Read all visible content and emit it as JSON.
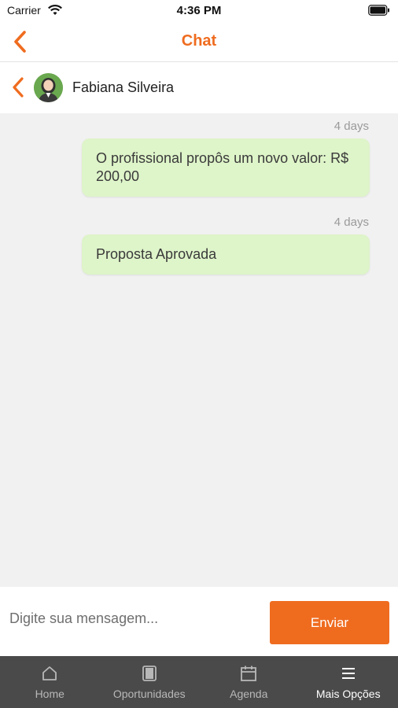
{
  "status_bar": {
    "carrier": "Carrier",
    "time": "4:36 PM"
  },
  "header": {
    "title": "Chat",
    "back_icon": "chevron-left-icon"
  },
  "contact": {
    "name": "Fabiana Silveira",
    "avatar_icon": "user-avatar"
  },
  "messages": [
    {
      "time": "4 days",
      "text": "O profissional propôs um novo valor: R$ 200,00"
    },
    {
      "time": "4 days",
      "text": "Proposta Aprovada"
    }
  ],
  "composer": {
    "placeholder": "Digite sua mensagem...",
    "send_label": "Enviar"
  },
  "tabs": [
    {
      "label": "Home",
      "icon": "home-icon"
    },
    {
      "label": "Oportunidades",
      "icon": "tablet-icon"
    },
    {
      "label": "Agenda",
      "icon": "calendar-icon"
    },
    {
      "label": "Mais Opções",
      "icon": "menu-icon",
      "active": true
    }
  ],
  "colors": {
    "accent": "#ef6c1f",
    "bubble": "#def4c9",
    "background": "#f1f1f1",
    "tab_bar": "#4a4a4a"
  }
}
